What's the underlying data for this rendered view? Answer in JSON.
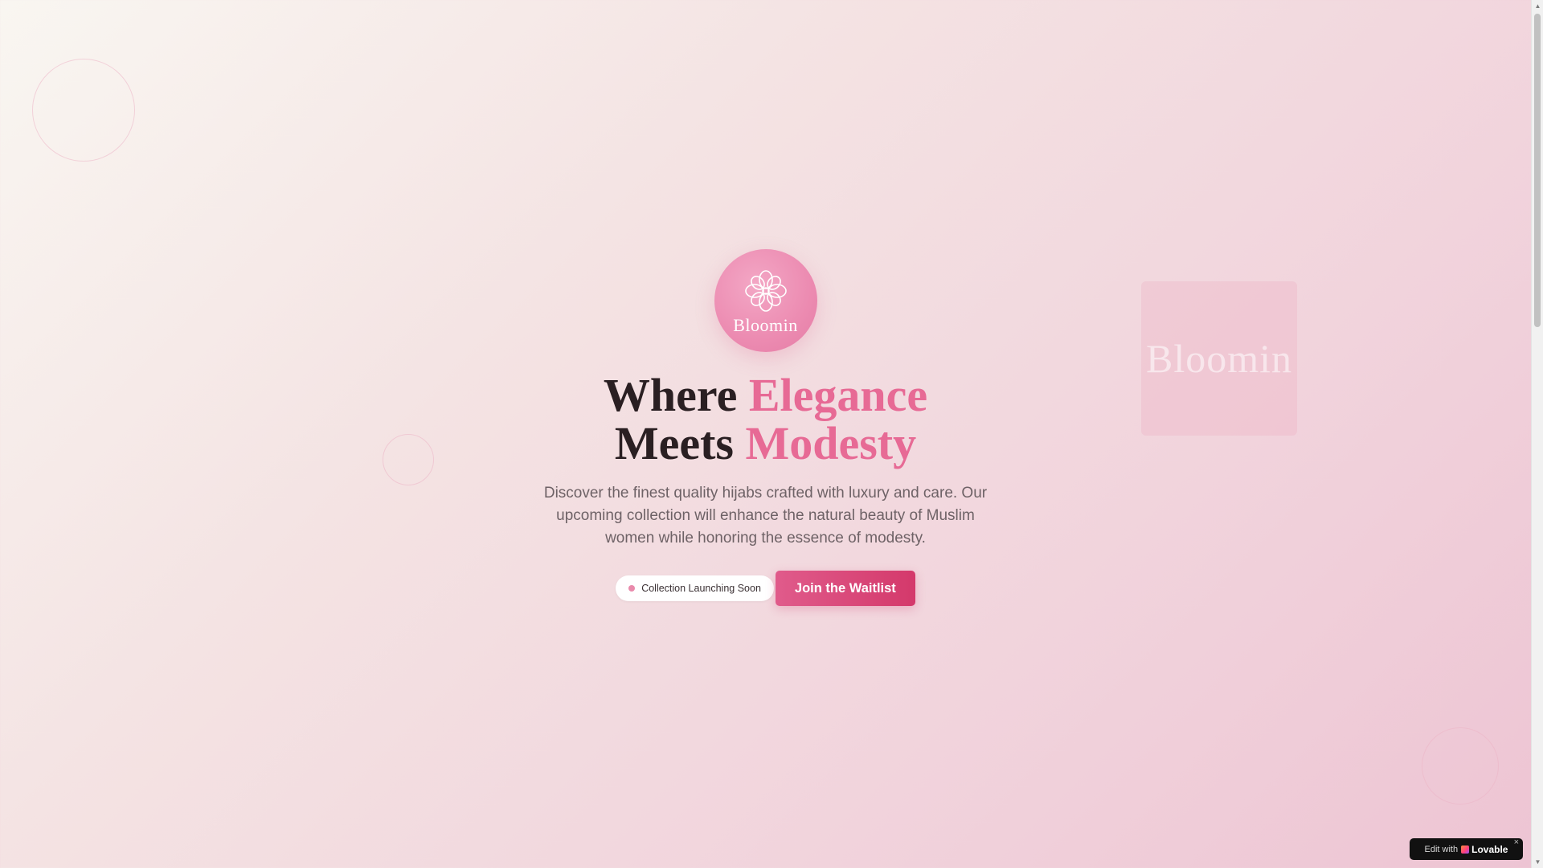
{
  "brand": {
    "logo_text": "Bloomin",
    "float_card_text": "Bloomin"
  },
  "hero": {
    "headline_line1_plain": "Where ",
    "headline_line1_accent": "Elegance",
    "headline_line2_plain": "Meets ",
    "headline_line2_accent": "Modesty",
    "subtitle": "Discover the finest quality hijabs crafted with luxury and care. Our upcoming collection will enhance the natural beauty of Muslim women while honoring the essence of modesty."
  },
  "cta": {
    "badge_label": "Collection Launching Soon",
    "button_label": "Join the Waitlist"
  },
  "edit_badge": {
    "prefix": "Edit with",
    "brand": "Lovable",
    "close": "×"
  },
  "scrollbar": {
    "up": "▲",
    "down": "▼"
  },
  "colors": {
    "accent": "#e76a95",
    "button": "#d4396b",
    "heading": "#2a1f22",
    "body_text": "#6e6266"
  },
  "icons": {
    "logo": "flower-icon",
    "badge": "status-dot-icon",
    "edit_brand": "lovable-heart-icon"
  }
}
